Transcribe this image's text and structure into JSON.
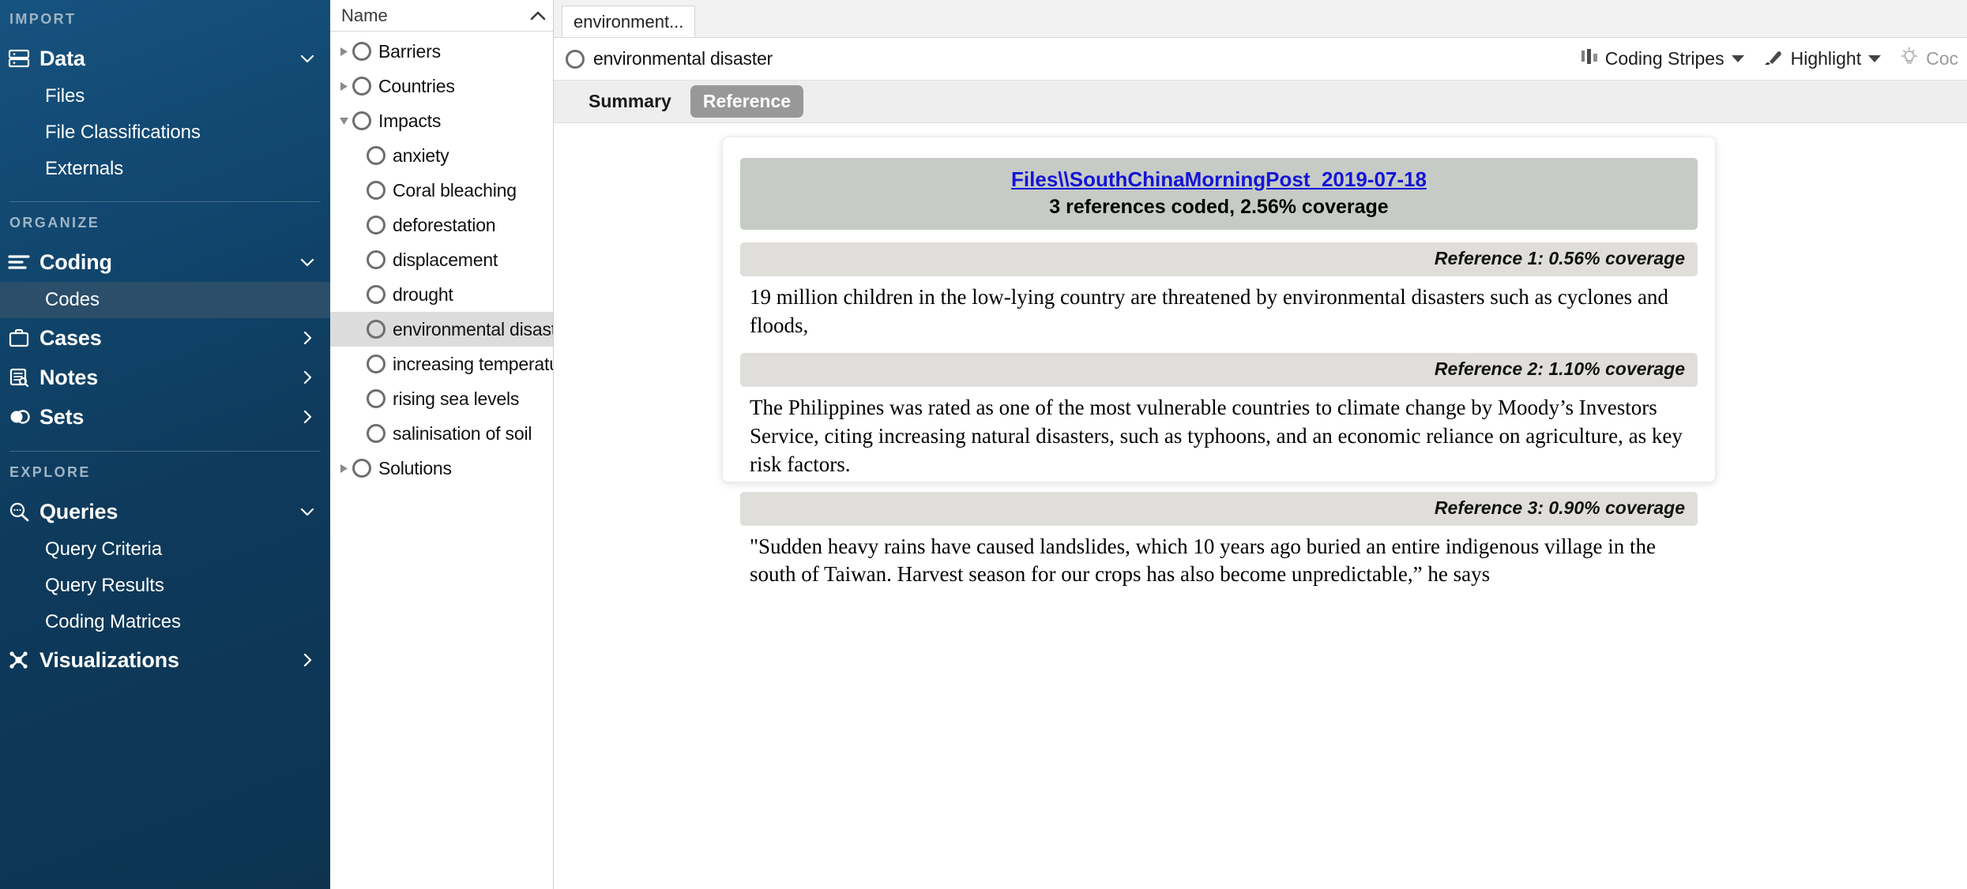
{
  "sidebar": {
    "sections": [
      {
        "label": "IMPORT",
        "groups": [
          {
            "icon": "database-icon",
            "label": "Data",
            "expanded": true,
            "chevron": "chevron-down-icon",
            "children": [
              {
                "label": "Files",
                "selected": false
              },
              {
                "label": "File Classifications",
                "selected": false
              },
              {
                "label": "Externals",
                "selected": false
              }
            ]
          }
        ]
      },
      {
        "label": "ORGANIZE",
        "groups": [
          {
            "icon": "coding-lines-icon",
            "label": "Coding",
            "expanded": true,
            "chevron": "chevron-down-icon",
            "children": [
              {
                "label": "Codes",
                "selected": true
              }
            ]
          },
          {
            "icon": "briefcase-icon",
            "label": "Cases",
            "expanded": false,
            "chevron": "chevron-right-icon",
            "children": []
          },
          {
            "icon": "notes-icon",
            "label": "Notes",
            "expanded": false,
            "chevron": "chevron-right-icon",
            "children": []
          },
          {
            "icon": "sets-toggle-icon",
            "label": "Sets",
            "expanded": false,
            "chevron": "chevron-right-icon",
            "children": []
          }
        ]
      },
      {
        "label": "EXPLORE",
        "groups": [
          {
            "icon": "search-query-icon",
            "label": "Queries",
            "expanded": true,
            "chevron": "chevron-down-icon",
            "children": [
              {
                "label": "Query Criteria",
                "selected": false
              },
              {
                "label": "Query Results",
                "selected": false
              },
              {
                "label": "Coding Matrices",
                "selected": false
              }
            ]
          },
          {
            "icon": "visualizations-icon",
            "label": "Visualizations",
            "expanded": false,
            "chevron": "chevron-right-icon",
            "children": []
          }
        ]
      }
    ]
  },
  "tree_panel": {
    "column_header": "Name",
    "sort_icon": "chevron-up-icon",
    "rows": [
      {
        "label": "Barriers",
        "level": 0,
        "twisty": "collapsed",
        "selected": false
      },
      {
        "label": "Countries",
        "level": 0,
        "twisty": "collapsed",
        "selected": false
      },
      {
        "label": "Impacts",
        "level": 0,
        "twisty": "expanded",
        "selected": false
      },
      {
        "label": "anxiety",
        "level": 1,
        "twisty": "none",
        "selected": false
      },
      {
        "label": "Coral bleaching",
        "level": 1,
        "twisty": "none",
        "selected": false
      },
      {
        "label": "deforestation",
        "level": 1,
        "twisty": "none",
        "selected": false
      },
      {
        "label": "displacement",
        "level": 1,
        "twisty": "none",
        "selected": false
      },
      {
        "label": "drought",
        "level": 1,
        "twisty": "none",
        "selected": false
      },
      {
        "label": "environmental disaster",
        "level": 1,
        "twisty": "none",
        "selected": true
      },
      {
        "label": "increasing temperatures",
        "level": 1,
        "twisty": "none",
        "selected": false
      },
      {
        "label": "rising sea levels",
        "level": 1,
        "twisty": "none",
        "selected": false
      },
      {
        "label": "salinisation of soil",
        "level": 1,
        "twisty": "none",
        "selected": false
      },
      {
        "label": "Solutions",
        "level": 0,
        "twisty": "collapsed",
        "selected": false
      }
    ]
  },
  "detail": {
    "document_tab": "environment...",
    "item_name": "environmental disaster",
    "toolbar": [
      {
        "label": "Coding Stripes",
        "icon": "coding-stripes-icon",
        "has_caret": true,
        "dim": false
      },
      {
        "label": "Highlight",
        "icon": "highlighter-icon",
        "has_caret": true,
        "dim": false
      },
      {
        "label": "Coc",
        "icon": "lightbulb-icon",
        "has_caret": false,
        "dim": true
      }
    ],
    "mode_tabs": [
      {
        "label": "Summary",
        "active": false
      },
      {
        "label": "Reference",
        "active": true
      }
    ],
    "source": {
      "file_link": "Files\\\\SouthChinaMorningPost_2019-07-18",
      "coverage_summary": "3 references coded, 2.56% coverage"
    },
    "references": [
      {
        "header": "Reference 1: 0.56% coverage",
        "text": "19 million children in the low-lying country are threatened by environmental disasters such as cyclones and floods,"
      },
      {
        "header": "Reference 2: 1.10% coverage",
        "text": "The Philippines was rated as one of the most vulnerable countries to climate change by Moody’s Investors Service, citing increasing natural disasters, such as typhoons, and an economic reliance on agriculture, as key risk factors."
      },
      {
        "header": "Reference 3: 0.90% coverage",
        "text": "\"Sudden heavy rains have caused landslides, which 10 years ago buried an entire indigenous village in the south of Taiwan. Harvest season for our crops has also become unpredictable,” he says"
      }
    ]
  },
  "colors": {
    "sidebar_top": "#17537f",
    "sidebar_bottom": "#0d3350",
    "sidebar_selected": "#2b4e6b",
    "tree_selected": "#dcdcdc",
    "source_header_bg": "#c6cbc6",
    "reference_bar_bg": "#e0dedb",
    "link": "#1414d6",
    "active_tab_bg": "#989898"
  }
}
